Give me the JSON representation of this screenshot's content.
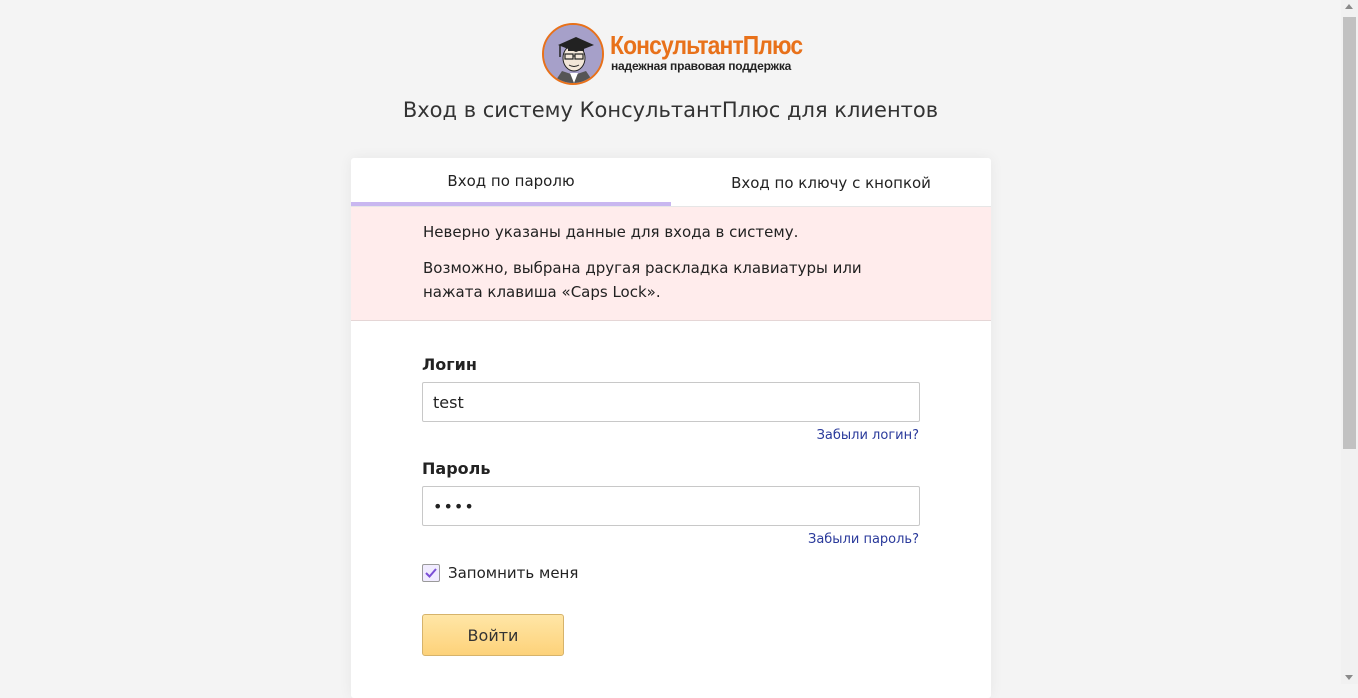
{
  "logo": {
    "title": "КонсультантПлюс",
    "subtitle": "надежная правовая поддержка"
  },
  "page_title": "Вход в систему КонсультантПлюс для клиентов",
  "tabs": [
    {
      "label": "Вход по паролю",
      "active": true
    },
    {
      "label": "Вход по ключу с кнопкой",
      "active": false
    }
  ],
  "alert": {
    "line1": "Неверно указаны данные для входа в систему.",
    "line2": "Возможно, выбрана другая раскладка клавиатуры или нажата клавиша «Caps Lock»."
  },
  "form": {
    "login_label": "Логин",
    "login_value": "test",
    "forgot_login": "Забыли логин?",
    "password_label": "Пароль",
    "password_value": "••••",
    "forgot_password": "Забыли пароль?",
    "remember_label": "Запомнить меня",
    "remember_checked": true,
    "submit_label": "Войти"
  },
  "colors": {
    "logo_orange": "#e8711a",
    "tab_active_underline": "#c9b7f0",
    "alert_bg": "#ffecec",
    "link": "#2a3a9b",
    "button": "#fdd27a",
    "checkmark": "#7b4fd6"
  }
}
